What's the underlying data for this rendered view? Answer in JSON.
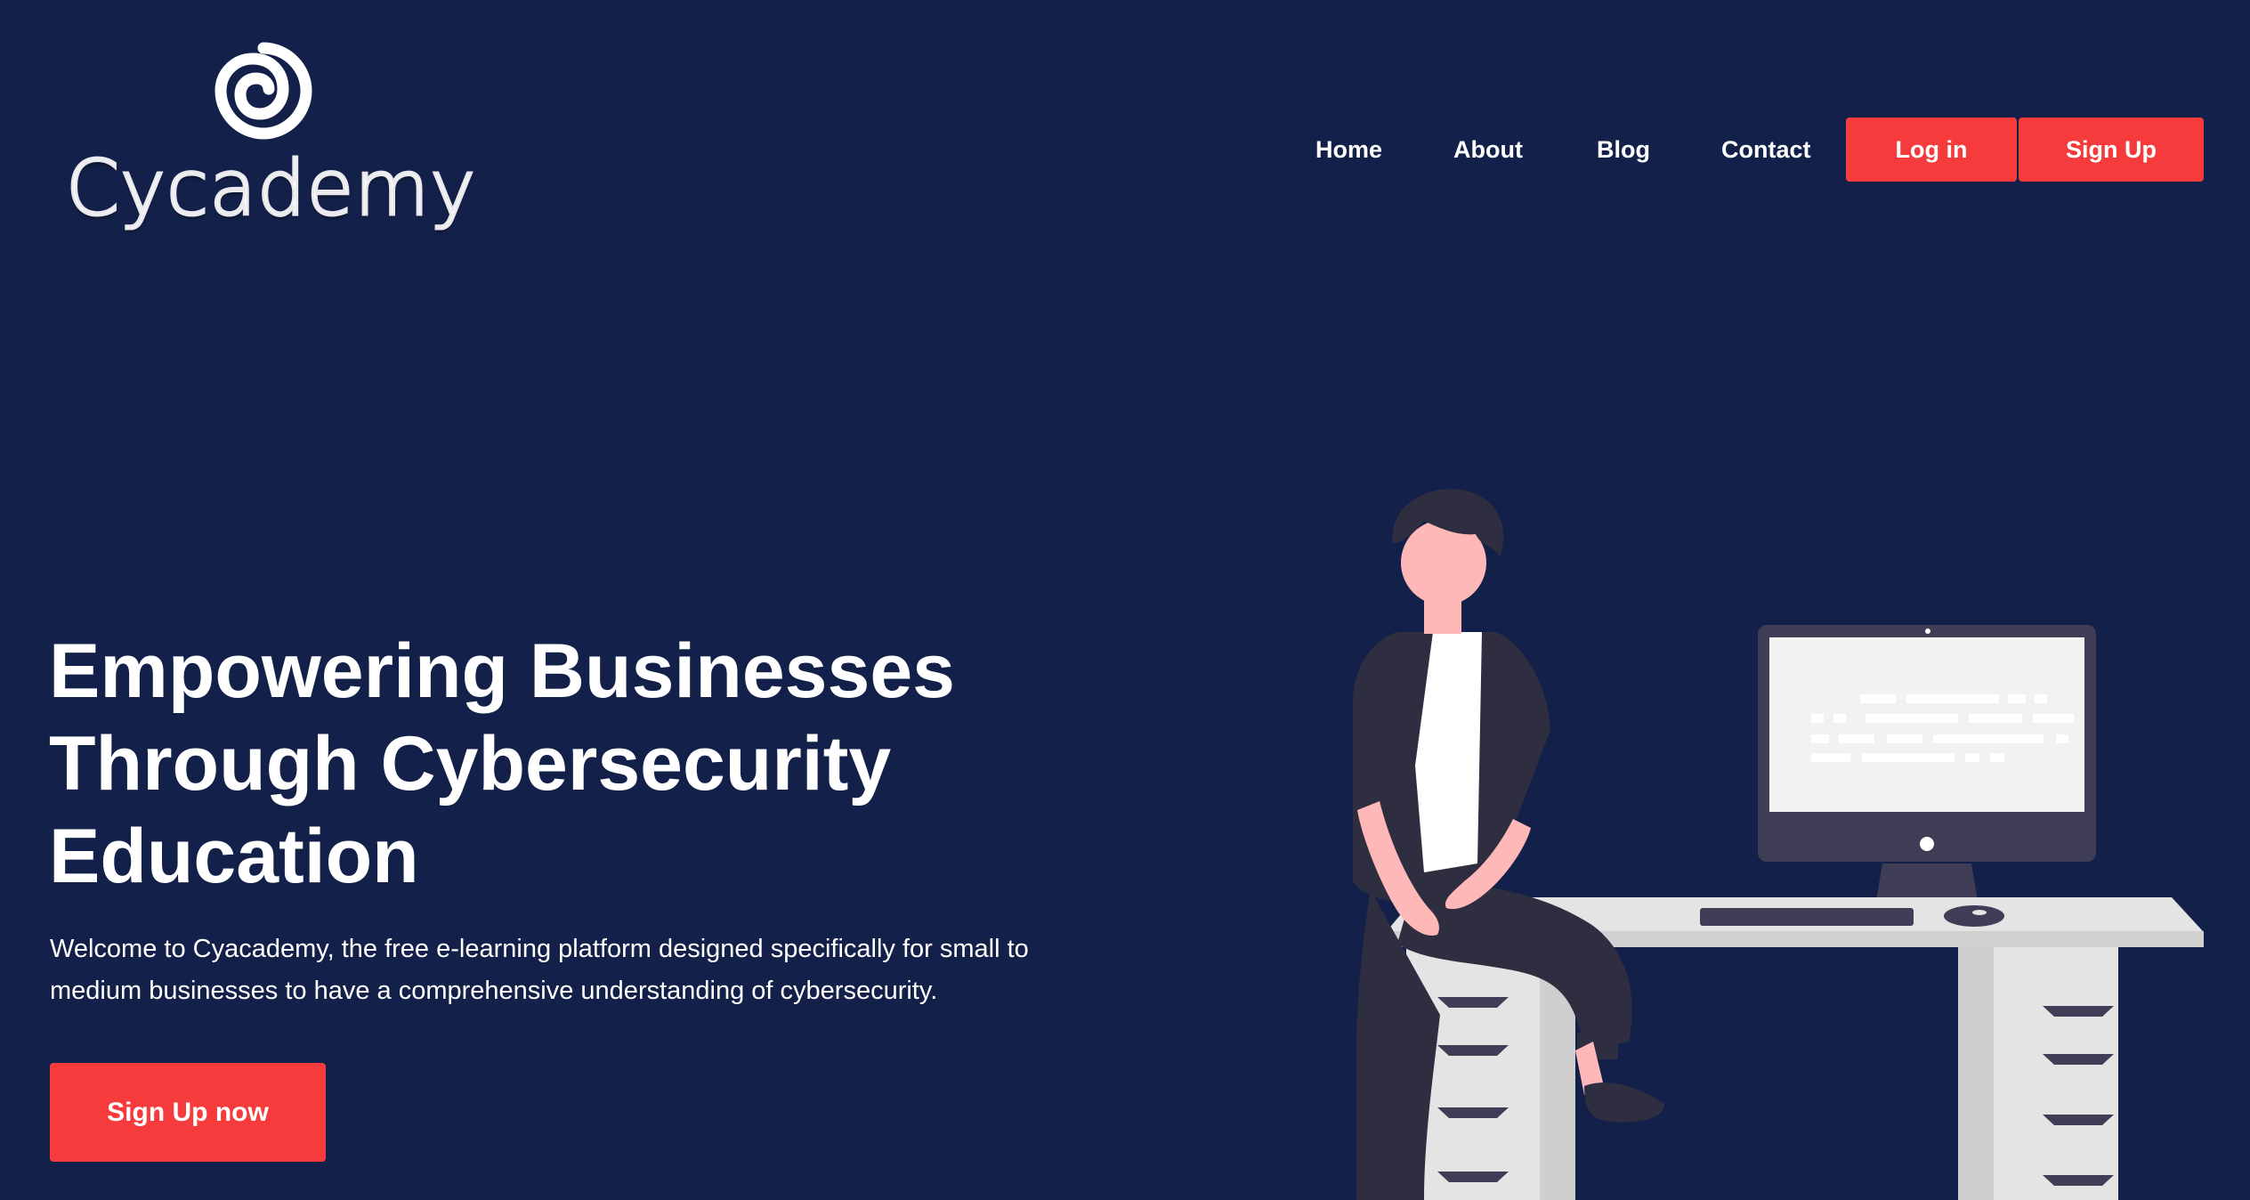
{
  "brand": {
    "name": "Cycademy"
  },
  "nav": {
    "items": [
      "Home",
      "About",
      "Blog",
      "Contact"
    ],
    "login": "Log in",
    "signup": "Sign Up"
  },
  "hero": {
    "title_lines": [
      "Empowering Businesses",
      "Through Cybersecurity",
      "Education"
    ],
    "subtitle_lines": [
      "Welcome to Cyacademy, the free e-learning platform designed specifically for small to",
      "medium businesses to have a comprehensive understanding of cybersecurity."
    ],
    "cta": "Sign Up now"
  },
  "theme": {
    "background": "#13214a",
    "accent": "#f53b3b",
    "text": "#ffffff"
  },
  "icons": {
    "logo": "spiral-icon",
    "illustration": "person-at-desk-illustration"
  }
}
